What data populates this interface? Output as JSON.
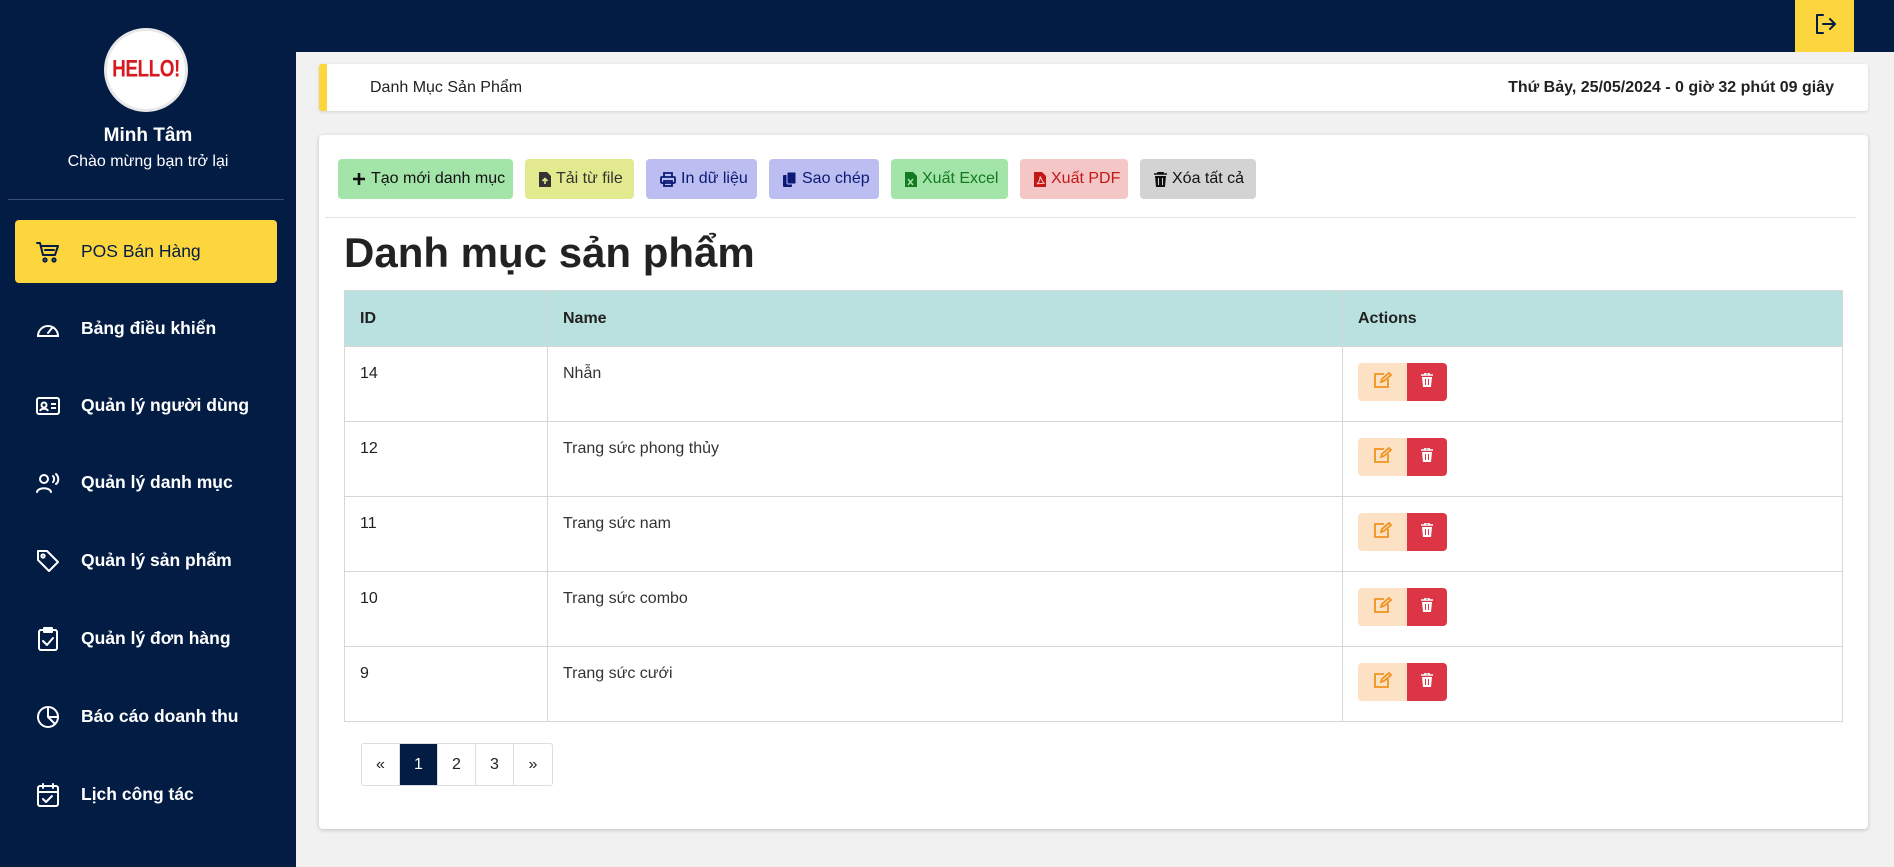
{
  "sidebar": {
    "logo_text": "HELLO!",
    "user_name": "Minh Tâm",
    "welcome": "Chào mừng bạn trở lại",
    "items": [
      {
        "label": "POS Bán Hàng",
        "icon": "cart-icon",
        "active": true
      },
      {
        "label": "Bảng điều khiển",
        "icon": "dashboard-gauge-icon"
      },
      {
        "label": "Quản lý người dùng",
        "icon": "id-card-icon"
      },
      {
        "label": "Quản lý danh mục",
        "icon": "user-voice-icon"
      },
      {
        "label": "Quản lý sản phẩm",
        "icon": "tag-icon"
      },
      {
        "label": "Quản lý đơn hàng",
        "icon": "clipboard-check-icon"
      },
      {
        "label": "Báo cáo doanh thu",
        "icon": "pie-chart-icon"
      },
      {
        "label": "Lịch công tác",
        "icon": "calendar-check-icon"
      }
    ]
  },
  "topbar": {
    "logout_icon": "logout-icon"
  },
  "header": {
    "breadcrumb": "Danh Mục Sản Phẩm",
    "clock": "Thứ Bảy, 25/05/2024 - 0 giờ 32 phút 09 giây"
  },
  "toolbar": {
    "create": "Tạo mới danh mục",
    "upload": "Tải từ file",
    "print": "In dữ liệu",
    "copy": "Sao chép",
    "excel": "Xuất Excel",
    "pdf": "Xuất PDF",
    "delete_all": "Xóa tất cả"
  },
  "page_title": "Danh mục sản phẩm",
  "table": {
    "headers": [
      "ID",
      "Name",
      "Actions"
    ],
    "rows": [
      {
        "id": "14",
        "name": "Nhẫn"
      },
      {
        "id": "12",
        "name": "Trang sức phong thủy"
      },
      {
        "id": "11",
        "name": "Trang sức nam"
      },
      {
        "id": "10",
        "name": "Trang sức combo"
      },
      {
        "id": "9",
        "name": "Trang sức cưới"
      }
    ]
  },
  "pagination": {
    "prev": "«",
    "pages": [
      "1",
      "2",
      "3"
    ],
    "current": "1",
    "next": "»"
  },
  "colors": {
    "sidebar_bg": "#031c44",
    "accent_yellow": "#fdd53c",
    "table_header": "#b9e1e0",
    "delete_red": "#dc3545"
  }
}
